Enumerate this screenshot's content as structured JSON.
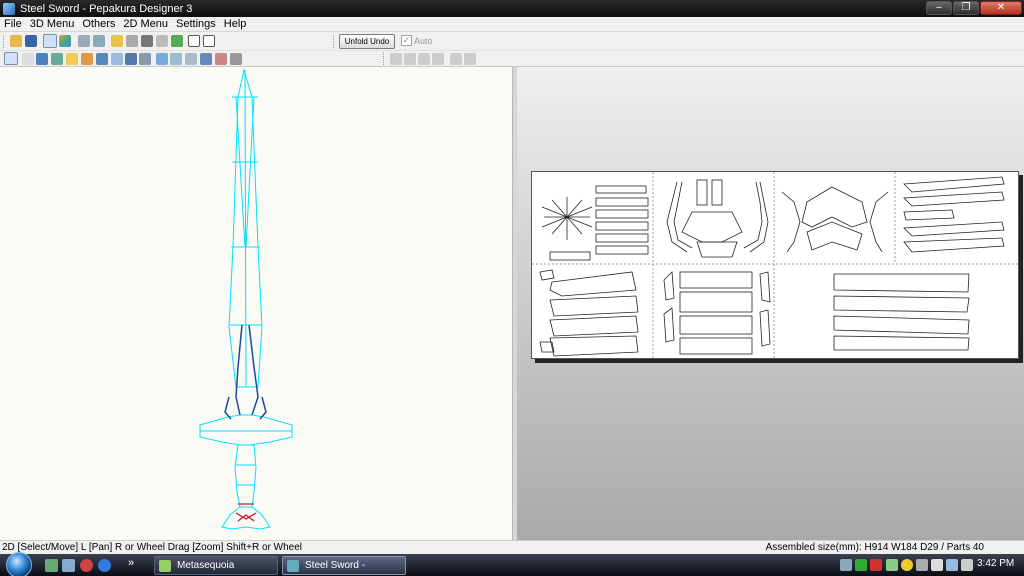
{
  "window": {
    "title": "Steel Sword - Pepakura Designer 3",
    "minimize_glyph": "–",
    "maximize_glyph": "❐",
    "close_glyph": "✕"
  },
  "menu": {
    "items": [
      "File",
      "3D Menu",
      "Others",
      "2D Menu",
      "Settings",
      "Help"
    ]
  },
  "toolbar": {
    "unfold_undo_label": "Unfold Undo",
    "auto_label": "Auto",
    "auto_checked": true
  },
  "status": {
    "left": "2D [Select/Move] L [Pan] R or Wheel Drag [Zoom] Shift+R or Wheel",
    "right": "Assembled size(mm): H914 W184 D29 / Parts 40"
  },
  "taskbar": {
    "tasks": [
      "Metasequoia",
      "Steel Sword - Pepaku..."
    ],
    "overflow_glyph": "»",
    "clock": "3:42 PM"
  },
  "colors": {
    "model_edge": "#00e0ff",
    "model_outline": "#1a4a9a",
    "model_accent": "#c8102e",
    "paper_bg": "#ffffff",
    "page_divider": "#9a9a9a"
  },
  "icons": {
    "toolbar1": [
      "open-icon",
      "save-icon",
      "texture-icon",
      "color-icon",
      "rotate-icon",
      "flip-icon",
      "edit-icon",
      "print-icon",
      "anchor-icon",
      "join-icon",
      "split-icon",
      "frame-icon",
      "frame2-icon"
    ],
    "toolbar2": [
      "select-icon",
      "pen-icon",
      "photo-icon",
      "fold-icon",
      "part-icon",
      "paper-icon",
      "scissors-icon",
      "link-icon",
      "undo-icon",
      "zoom-icon",
      "move-icon",
      "rotate2-icon",
      "line-icon",
      "box-icon",
      "page-icon"
    ]
  }
}
